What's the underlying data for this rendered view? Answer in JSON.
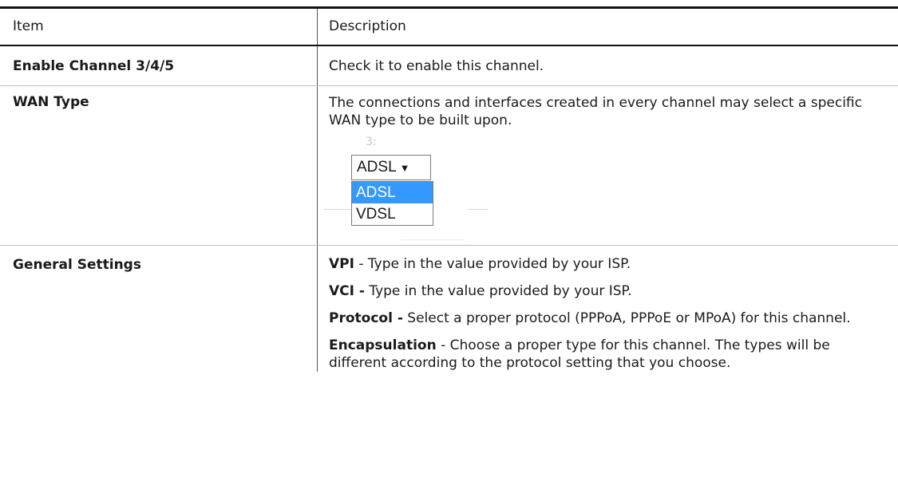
{
  "header": {
    "item": "Item",
    "description": "Description"
  },
  "rows": {
    "channel": {
      "item": "Enable Channel 3/4/5",
      "description": "Check it to enable this channel."
    },
    "wan": {
      "item": "WAN Type",
      "description": "The connections and interfaces created in every channel may select a specific WAN type to be built upon.",
      "select": {
        "faint_label": "3:",
        "value": "ADSL",
        "arrow": "▼",
        "options": [
          "ADSL",
          "VDSL"
        ],
        "selected_index": 0
      }
    },
    "general": {
      "item": "General Settings",
      "vpi_label": "VPI",
      "vpi_text": " - Type in the value provided by your ISP.",
      "vci_label": "VCI -",
      "vci_text": " Type in the value provided by your ISP.",
      "protocol_label": "Protocol -",
      "protocol_text": " Select a proper protocol (PPPoA, PPPoE or MPoA) for this channel.",
      "encap_label": "Encapsulation",
      "encap_text": " - Choose a proper type for this channel. The types will be different according to the protocol setting that you choose."
    }
  },
  "colors": {
    "selected_option_bg": "#3399ff",
    "rule": "#111111"
  }
}
